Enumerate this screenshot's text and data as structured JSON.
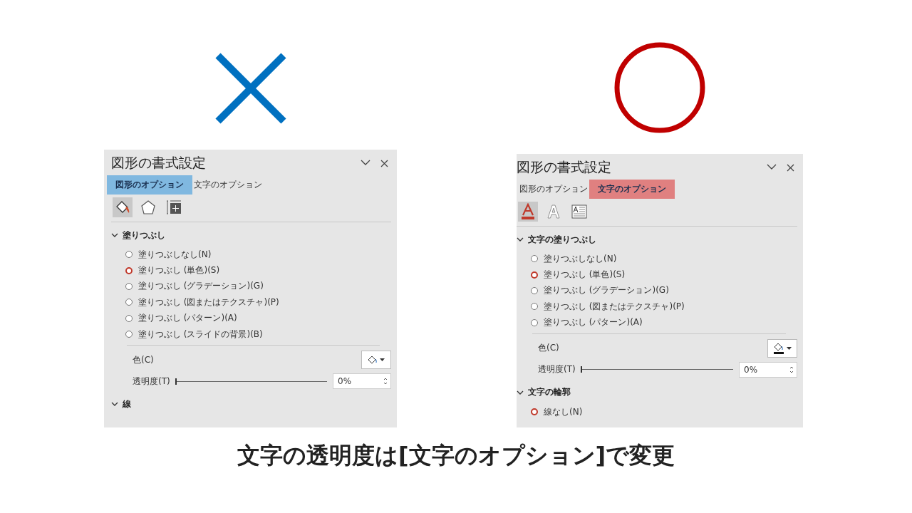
{
  "panes": [
    {
      "verdict": {
        "kind": "cross",
        "color": "#0070c0"
      },
      "title": "図形の書式設定",
      "tabs": [
        {
          "label": "図形のオプション",
          "selected": true
        },
        {
          "label": "文字のオプション",
          "selected": false
        }
      ],
      "icons": [
        {
          "kind": "bucket",
          "selected": true
        },
        {
          "kind": "pentagon",
          "selected": false
        },
        {
          "kind": "size",
          "selected": false
        }
      ],
      "sections": [
        {
          "title": "塗りつぶし",
          "expanded": true,
          "options": [
            {
              "label": "塗りつぶしなし(N)",
              "selected": false
            },
            {
              "label": "塗りつぶし (単色)(S)",
              "selected": true
            },
            {
              "label": "塗りつぶし (グラデーション)(G)",
              "selected": false
            },
            {
              "label": "塗りつぶし (図またはテクスチャ)(P)",
              "selected": false
            },
            {
              "label": "塗りつぶし (パターン)(A)",
              "selected": false
            },
            {
              "label": "塗りつぶし (スライドの背景)(B)",
              "selected": false
            }
          ],
          "color_label": "色(C)",
          "color_underline": false,
          "transparency_label": "透明度(T)",
          "transparency_value": "0%",
          "level": 0
        },
        {
          "title": "線",
          "expanded": true
        }
      ]
    },
    {
      "verdict": {
        "kind": "circle",
        "color": "#c00000"
      },
      "title": "図形の書式設定",
      "tabs": [
        {
          "label": "図形のオプション",
          "selected": false
        },
        {
          "label": "文字のオプション",
          "selected": true
        }
      ],
      "icons": [
        {
          "kind": "text-fill",
          "selected": true
        },
        {
          "kind": "text-outline",
          "selected": false
        },
        {
          "kind": "textbox",
          "selected": false
        }
      ],
      "sections": [
        {
          "title": "文字の塗りつぶし",
          "expanded": true,
          "options": [
            {
              "label": "塗りつぶしなし(N)",
              "selected": false
            },
            {
              "label": "塗りつぶし (単色)(S)",
              "selected": true
            },
            {
              "label": "塗りつぶし (グラデーション)(G)",
              "selected": false
            },
            {
              "label": "塗りつぶし (図またはテクスチャ)(P)",
              "selected": false
            },
            {
              "label": "塗りつぶし (パターン)(A)",
              "selected": false
            }
          ],
          "color_label": "色(C)",
          "color_underline": true,
          "transparency_label": "透明度(T)",
          "transparency_value": "0%",
          "level": 0
        },
        {
          "title": "文字の輪郭",
          "expanded": true,
          "options": [
            {
              "label": "線なし(N)",
              "selected": true
            }
          ]
        }
      ]
    }
  ],
  "caption": "文字の透明度は[文字のオプション]で変更"
}
